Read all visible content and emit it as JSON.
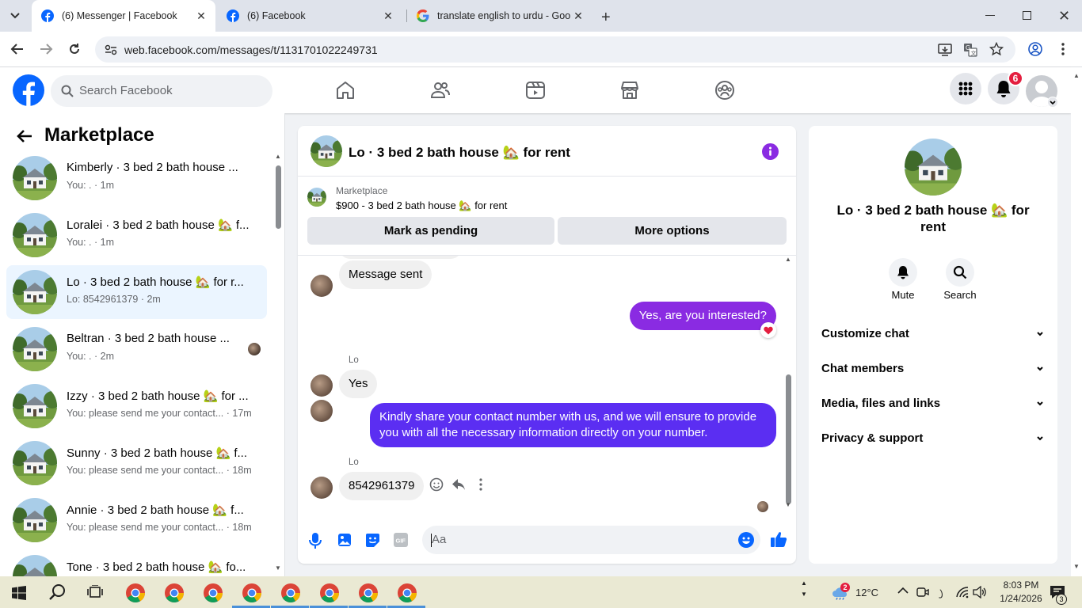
{
  "browser": {
    "tabs": [
      {
        "title": "(6) Messenger | Facebook",
        "active": true
      },
      {
        "title": "(6) Facebook",
        "active": false
      },
      {
        "title": "translate english to urdu - Goo",
        "active": false
      }
    ],
    "url": "web.facebook.com/messages/t/1131701022249731"
  },
  "fb_header": {
    "search_placeholder": "Search Facebook",
    "notification_count": "6"
  },
  "sidebar": {
    "title": "Marketplace",
    "threads": [
      {
        "name": "Kimberly · 3 bed 2 bath house ...",
        "sub": "You: . · 1m",
        "selected": false
      },
      {
        "name": "Loralei · 3 bed 2 bath house 🏡 f...",
        "sub": "You: . · 1m",
        "selected": false
      },
      {
        "name": "Lo · 3 bed 2 bath house 🏡 for r...",
        "sub": "Lo: 8542961379 · 2m",
        "selected": true
      },
      {
        "name": "Beltran · 3 bed 2 bath house ...",
        "sub": "You: . · 2m",
        "selected": false
      },
      {
        "name": "Izzy · 3 bed 2 bath house 🏡 for ...",
        "sub": "You: please send me your contact... · 17m",
        "selected": false
      },
      {
        "name": "Sunny · 3 bed 2 bath house 🏡 f...",
        "sub": "You: please send me your contact... · 18m",
        "selected": false
      },
      {
        "name": "Annie · 3 bed 2 bath house 🏡 f...",
        "sub": "You: please send me your contact... · 18m",
        "selected": false
      },
      {
        "name": "Tone · 3 bed 2 bath house 🏡 fo...",
        "sub": "",
        "selected": false
      }
    ]
  },
  "chat": {
    "title": "Lo · 3 bed 2 bath house 🏡 for rent",
    "listing_source": "Marketplace",
    "listing_title": "$900 - 3 bed 2 bath house 🏡 for rent",
    "mark_pending": "Mark as pending",
    "more_options": "More options",
    "messages": {
      "m1": "Message sent",
      "m2": "Yes, are you interested?",
      "m2_reaction": "❤️",
      "sender1": "Lo",
      "m3": "Yes",
      "m4": "Kindly share your contact number with us, and we will ensure to provide you with all the necessary information directly on your number.",
      "sender2": "Lo",
      "m5": "8542961379"
    },
    "composer_placeholder": "Aa"
  },
  "info_panel": {
    "title": "Lo · 3 bed 2 bath house 🏡 for rent",
    "mute": "Mute",
    "search": "Search",
    "sections": [
      "Customize chat",
      "Chat members",
      "Media, files and links",
      "Privacy & support"
    ]
  },
  "taskbar": {
    "weather_badge": "2",
    "temperature": "12°C",
    "time": "8:03 PM",
    "date": "1/24/2026",
    "notif_count": "3"
  },
  "colors": {
    "fb_blue": "#0866ff",
    "messenger_purple": "#8a2be2",
    "notif_red": "#e41e3f"
  }
}
